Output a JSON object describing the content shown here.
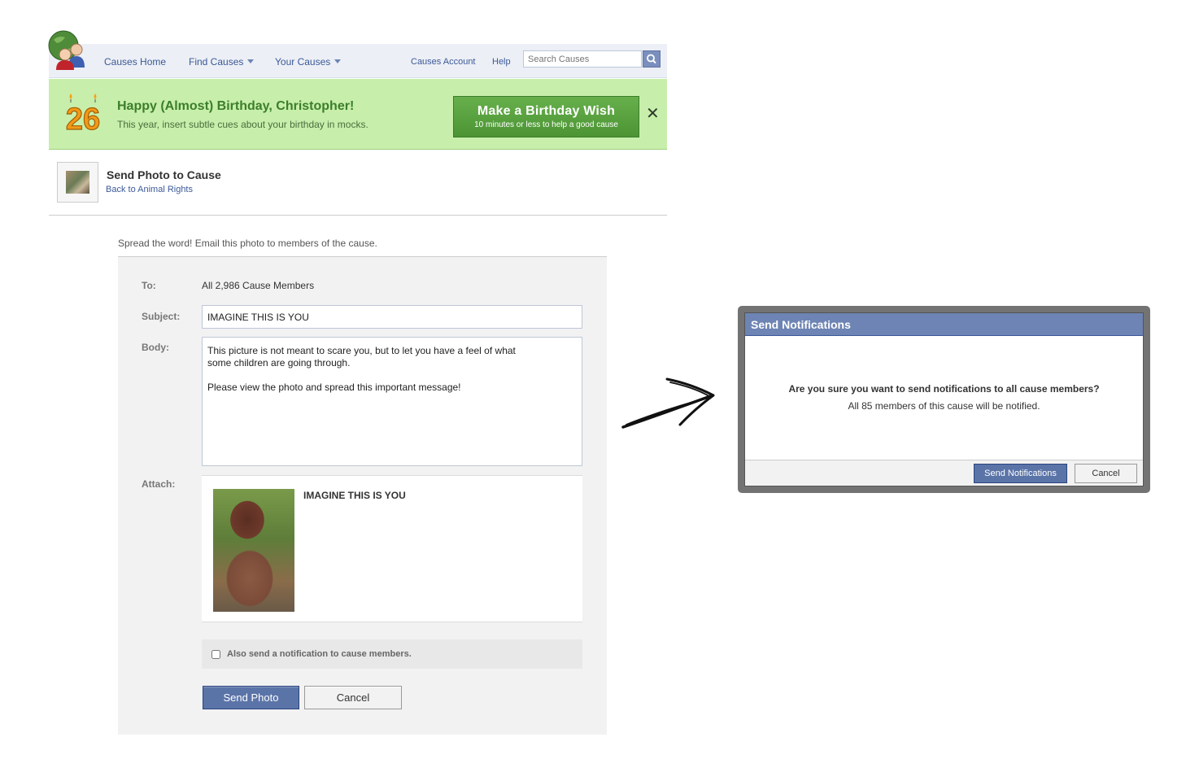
{
  "nav": {
    "causes_home": "Causes Home",
    "find_causes": "Find Causes",
    "your_causes": "Your Causes",
    "causes_account": "Causes Account",
    "help": "Help",
    "search_placeholder": "Search Causes"
  },
  "banner": {
    "age": "26",
    "title": "Happy (Almost) Birthday, Christopher!",
    "subtitle": "This year, insert subtle cues about your birthday in mocks.",
    "wish_button": "Make a Birthday Wish",
    "wish_sub": "10 minutes or less to help a good cause",
    "close": "✕"
  },
  "header": {
    "title": "Send Photo to Cause",
    "back_link": "Back to Animal Rights"
  },
  "form": {
    "intro": "Spread the word! Email this photo to members of the cause.",
    "to_label": "To:",
    "to_value": "All 2,986 Cause Members",
    "subject_label": "Subject:",
    "subject_value": "IMAGINE THIS IS YOU",
    "body_label": "Body:",
    "body_value": "This picture is not meant to scare you, but to let you have a feel of what\nsome children are going through.\n\nPlease view the photo and spread this important message!",
    "attach_label": "Attach:",
    "attach_title": "IMAGINE THIS IS YOU",
    "notify_label": "Also send a notification to cause members.",
    "notify_checked": false,
    "send_button": "Send Photo",
    "cancel_button": "Cancel"
  },
  "dialog": {
    "title": "Send Notifications",
    "question": "Are you sure you want to send notifications to all cause members?",
    "detail": "All 85 members of this cause will be notified.",
    "send_button": "Send Notifications",
    "cancel_button": "Cancel"
  },
  "colors": {
    "brand_blue": "#3b5998",
    "title_bar": "#6d84b4",
    "banner_green": "#c7efab",
    "wish_green": "#5aa33f"
  }
}
